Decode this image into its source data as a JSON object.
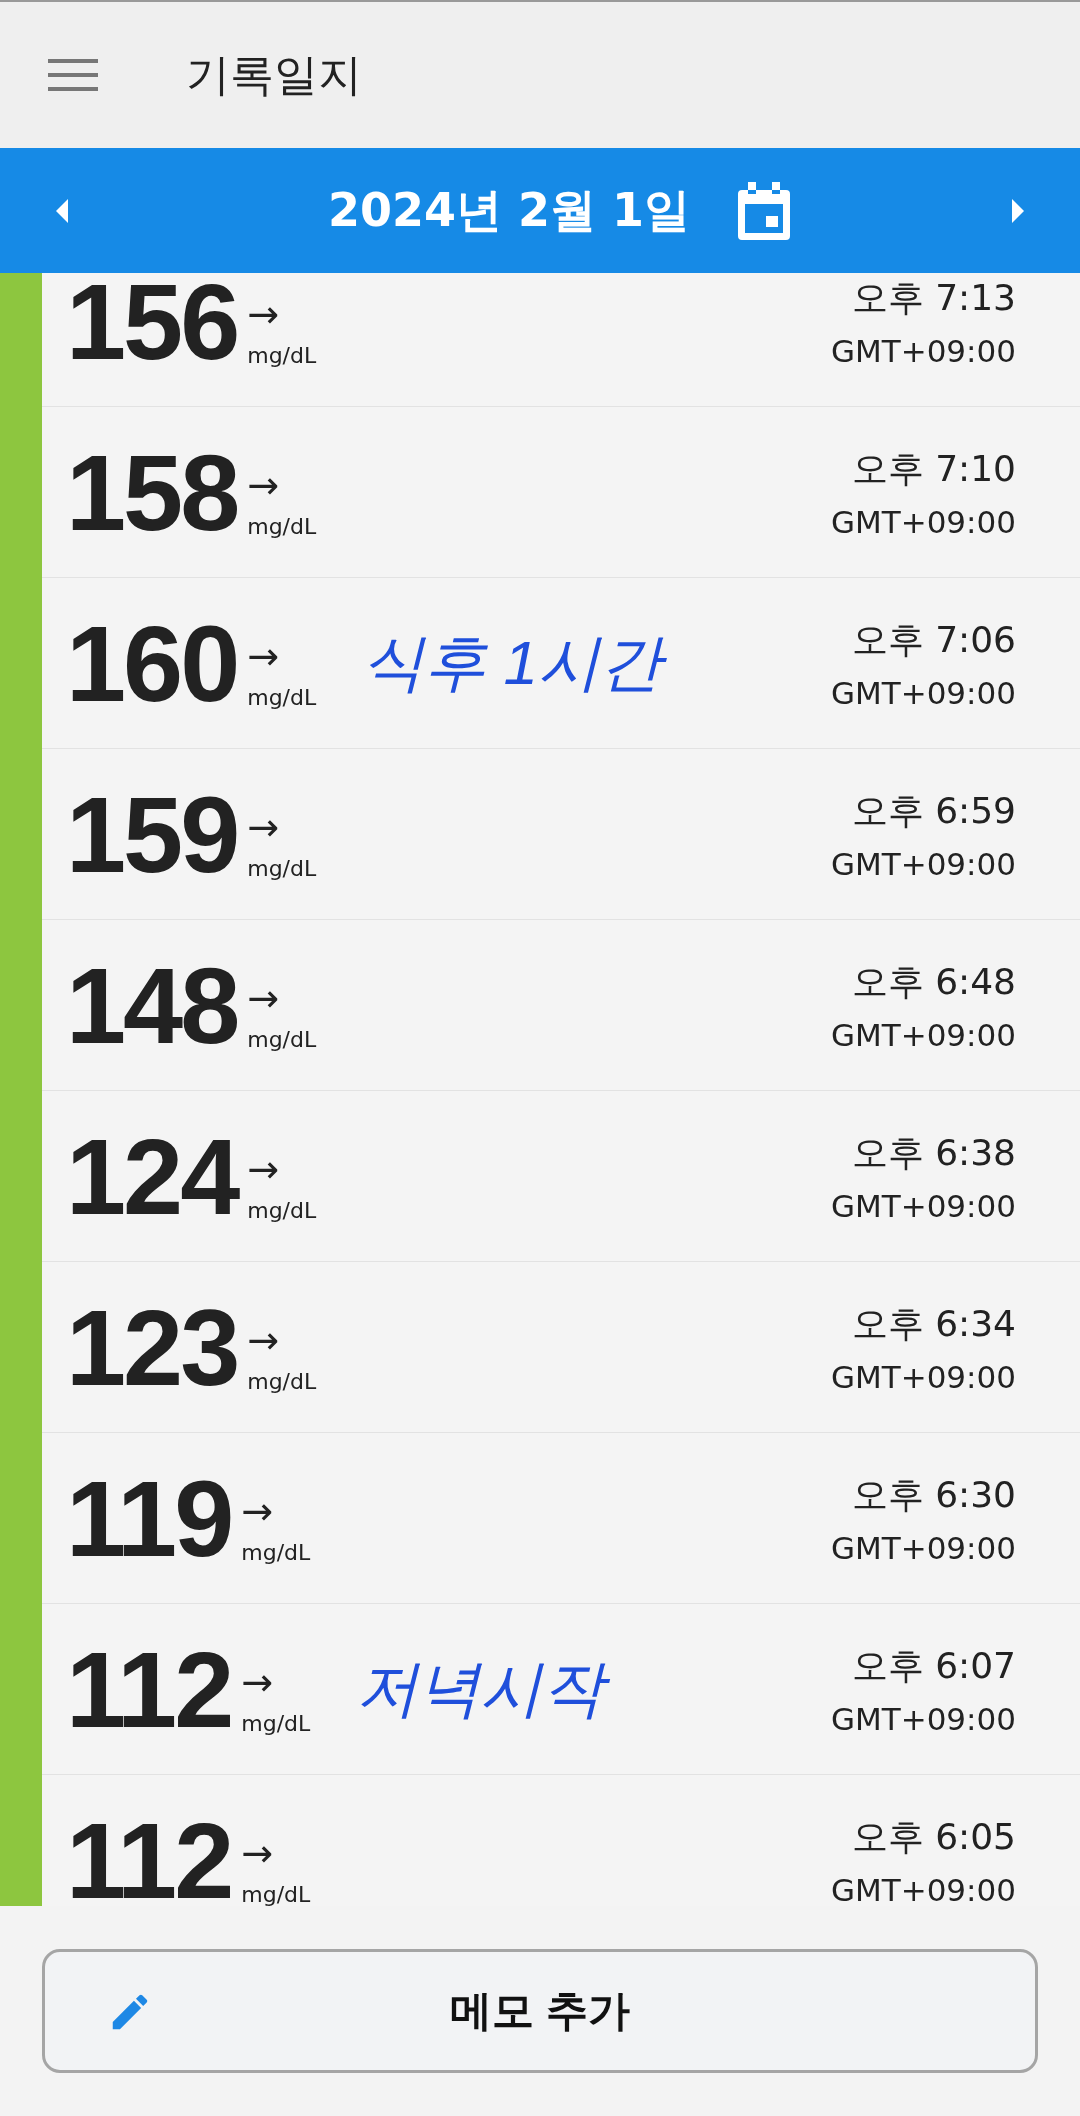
{
  "app_bar": {
    "title": "기록일지"
  },
  "date_bar": {
    "date": "2024년 2월 1일"
  },
  "readings": [
    {
      "value": "156",
      "trend": "→",
      "unit": "mg/dL",
      "time": "오후 7:13",
      "timezone": "GMT+09:00",
      "color": "#8dc63f"
    },
    {
      "value": "158",
      "trend": "→",
      "unit": "mg/dL",
      "time": "오후 7:10",
      "timezone": "GMT+09:00",
      "color": "#8dc63f"
    },
    {
      "value": "160",
      "trend": "→",
      "unit": "mg/dL",
      "note": "식후 1시간",
      "time": "오후 7:06",
      "timezone": "GMT+09:00",
      "color": "#8dc63f"
    },
    {
      "value": "159",
      "trend": "→",
      "unit": "mg/dL",
      "time": "오후 6:59",
      "timezone": "GMT+09:00",
      "color": "#8dc63f"
    },
    {
      "value": "148",
      "trend": "→",
      "unit": "mg/dL",
      "time": "오후 6:48",
      "timezone": "GMT+09:00",
      "color": "#8dc63f"
    },
    {
      "value": "124",
      "trend": "→",
      "unit": "mg/dL",
      "time": "오후 6:38",
      "timezone": "GMT+09:00",
      "color": "#8dc63f"
    },
    {
      "value": "123",
      "trend": "→",
      "unit": "mg/dL",
      "time": "오후 6:34",
      "timezone": "GMT+09:00",
      "color": "#8dc63f"
    },
    {
      "value": "119",
      "trend": "→",
      "unit": "mg/dL",
      "time": "오후 6:30",
      "timezone": "GMT+09:00",
      "color": "#8dc63f"
    },
    {
      "value": "112",
      "trend": "→",
      "unit": "mg/dL",
      "note": "저녁시작",
      "time": "오후 6:07",
      "timezone": "GMT+09:00",
      "color": "#8dc63f"
    },
    {
      "value": "112",
      "trend": "→",
      "unit": "mg/dL",
      "time": "오후 6:05",
      "timezone": "GMT+09:00",
      "color": "#8dc63f"
    }
  ],
  "memo_button": {
    "label": "메모 추가"
  }
}
